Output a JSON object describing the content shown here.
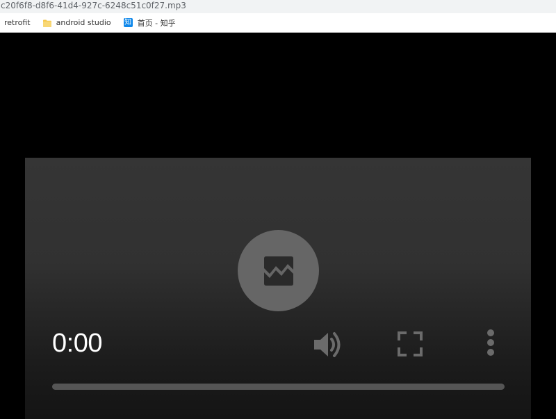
{
  "window": {
    "title": "c20f6f8-d8f6-41d4-927c-6248c51c0f27.mp3"
  },
  "bookmarks": [
    {
      "label": "retrofit",
      "icon": "none"
    },
    {
      "label": "android studio",
      "icon": "folder-icon"
    },
    {
      "label": "首页 - 知乎",
      "icon": "zhihu-icon",
      "icon_glyph": "知"
    }
  ],
  "player": {
    "time": "0:00",
    "progress": 0,
    "state_icon": "broken-image-icon",
    "controls": [
      "volume-icon",
      "fullscreen-icon",
      "more-options-icon"
    ]
  },
  "colors": {
    "accent_zhihu": "#0f88eb",
    "folder": "#f6c94f",
    "player_bg_top": "#353535",
    "control_icon": "#6b6b6b"
  }
}
